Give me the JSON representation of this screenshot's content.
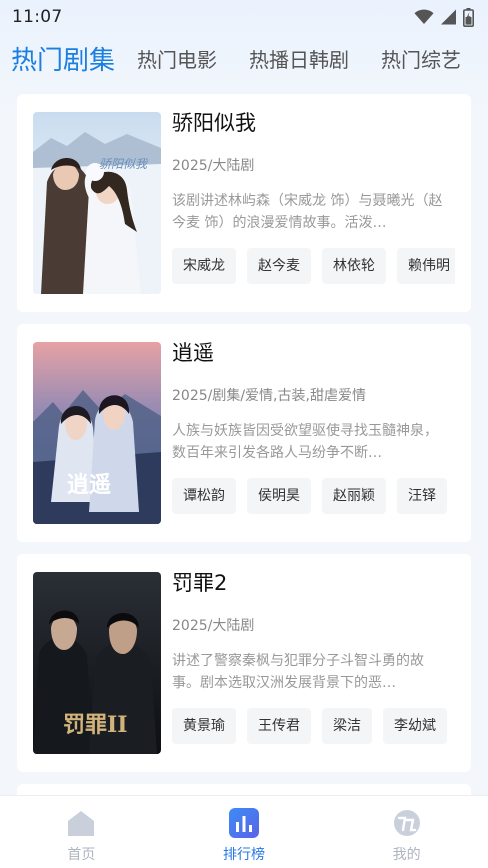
{
  "status_bar": {
    "time": "11:07",
    "icons": [
      "wifi-icon",
      "signal-icon",
      "battery-icon"
    ]
  },
  "tabs": [
    {
      "label": "热门剧集",
      "active": true
    },
    {
      "label": "热门电影",
      "active": false
    },
    {
      "label": "热播日韩剧",
      "active": false
    },
    {
      "label": "热门综艺",
      "active": false
    }
  ],
  "shows": [
    {
      "title": "骄阳似我",
      "meta": "2025/大陆剧",
      "description": "该剧讲述林屿森（宋威龙 饰）与聂曦光（赵今麦 饰）的浪漫爱情故事。活泼…",
      "cast": [
        "宋威龙",
        "赵今麦",
        "林依轮",
        "赖伟明"
      ],
      "poster_text": "骄阳似我"
    },
    {
      "title": "逍遥",
      "meta": "2025/剧集/爱情,古装,甜虐爱情",
      "description": "人族与妖族皆因受欲望驱使寻找玉髓神泉，数百年来引发各路人马纷争不断…",
      "cast": [
        "谭松韵",
        "侯明昊",
        "赵丽颖",
        "汪铎"
      ],
      "poster_text": "逍遥"
    },
    {
      "title": "罚罪2",
      "meta": "2025/大陆剧",
      "description": "讲述了警察秦枫与犯罪分子斗智斗勇的故事。剧本选取汉洲发展背景下的恶…",
      "cast": [
        "黄景瑜",
        "王传君",
        "梁洁",
        "李幼斌"
      ],
      "poster_text": "罚罪II"
    }
  ],
  "bottom_nav": [
    {
      "label": "首页",
      "icon": "home-icon",
      "active": false
    },
    {
      "label": "排行榜",
      "icon": "bar-chart-icon",
      "active": true
    },
    {
      "label": "我的",
      "icon": "profile-icon",
      "active": false
    }
  ],
  "colors": {
    "accent": "#1a7fe0",
    "nav_active": "#2a77e6",
    "nav_inactive": "#aeb4c0"
  }
}
